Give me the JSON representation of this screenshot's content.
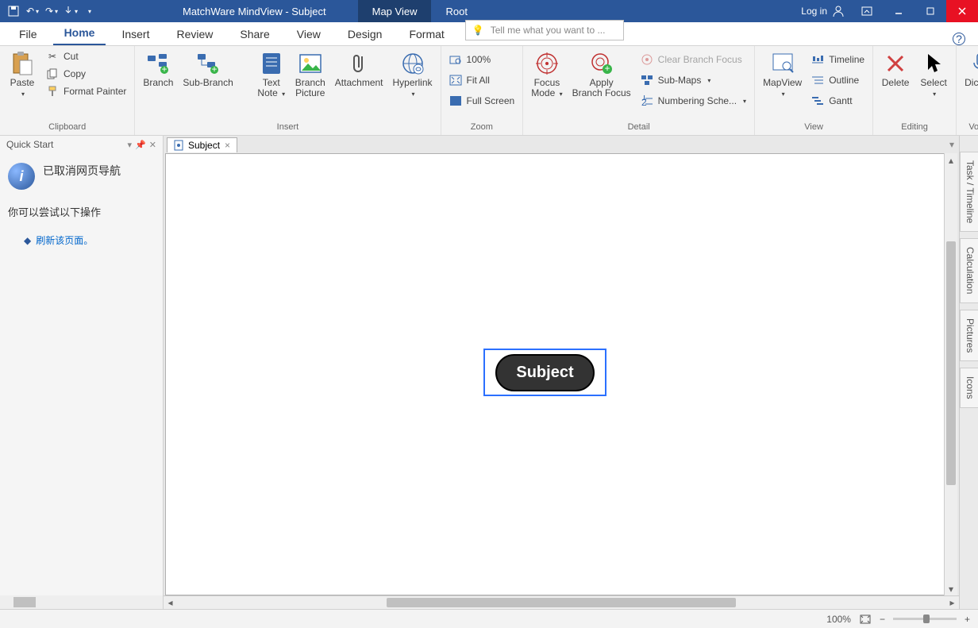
{
  "title": "MatchWare MindView - Subject",
  "title_tabs": [
    "Map View",
    "Root"
  ],
  "login": "Log in",
  "ribbon_tabs": [
    "File",
    "Home",
    "Insert",
    "Review",
    "Share",
    "View",
    "Design",
    "Format"
  ],
  "search_placeholder": "Tell me what you want to ...",
  "clipboard": {
    "paste": "Paste",
    "cut": "Cut",
    "copy": "Copy",
    "format_painter": "Format Painter",
    "label": "Clipboard"
  },
  "insert": {
    "branch": "Branch",
    "sub_branch": "Sub-Branch",
    "text_note": "Text\nNote",
    "branch_picture": "Branch\nPicture",
    "attachment": "Attachment",
    "hyperlink": "Hyperlink",
    "label": "Insert"
  },
  "zoom": {
    "p100": "100%",
    "fit_all": "Fit All",
    "full_screen": "Full Screen",
    "label": "Zoom"
  },
  "detail": {
    "focus_mode": "Focus\nMode",
    "apply_focus": "Apply\nBranch Focus",
    "clear_focus": "Clear Branch Focus",
    "sub_maps": "Sub-Maps",
    "numbering": "Numbering Sche...",
    "label": "Detail"
  },
  "view": {
    "mapview": "MapView",
    "timeline": "Timeline",
    "outline": "Outline",
    "gantt": "Gantt",
    "label": "View"
  },
  "editing": {
    "delete": "Delete",
    "select": "Select",
    "label": "Editing"
  },
  "voice": {
    "dictate": "Dictate",
    "label": "Voice"
  },
  "quickstart": {
    "title": "Quick Start",
    "msg": "已取消网页导航",
    "try": "你可以尝试以下操作",
    "refresh": "刷新该页面。"
  },
  "doc_tab": "Subject",
  "node_text": "Subject",
  "side_tabs": [
    "Task / Timeline",
    "Calculation",
    "Pictures",
    "Icons"
  ],
  "status": {
    "zoom": "100%"
  }
}
